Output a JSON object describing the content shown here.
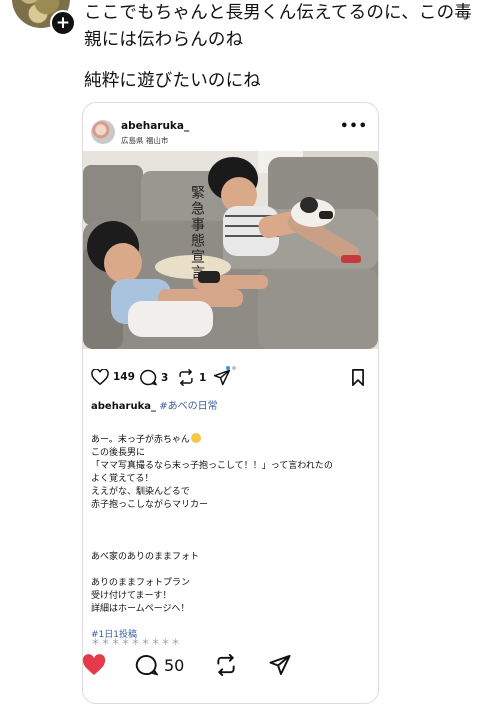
{
  "post": {
    "text_line1": "ここでもちゃんと長男くん伝えてるのに、この毒",
    "text_line2": "親には伝わらんのね",
    "text_line3": "純粋に遊びたいのにね",
    "follow_symbol": "+"
  },
  "embed": {
    "username": "abeharuka_",
    "location": "広島県 福山市",
    "more_label": "•••",
    "photo_title": "緊急事態宣言",
    "likes": "149",
    "comments": "3",
    "reposts": "1",
    "owner": "abeharuka_",
    "owner_hashtag": "#あべの日常",
    "caption": [
      "あー。末っ子が赤ちゃん",
      "この後長男に",
      "「ママ写真撮るなら末っ子抱っこして！！」って言われたの",
      "よく覚えてる！",
      "ええがな、馴染んどるで",
      "赤子抱っこしながらマリカー",
      "",
      "",
      "",
      "あべ家のありのままフォト",
      "",
      "ありのままフォトプラン",
      "受け付けてまーす！",
      "詳細はホームページへ！",
      "",
      "#1日1投稿"
    ],
    "stars": "＊＊＊＊＊＊＊＊＊"
  },
  "bottom": {
    "comment_count": "50"
  },
  "colors": {
    "hashtag": "#3b5da0",
    "heart_liked": "#e53a4c",
    "dot_active": "#3897f0"
  }
}
